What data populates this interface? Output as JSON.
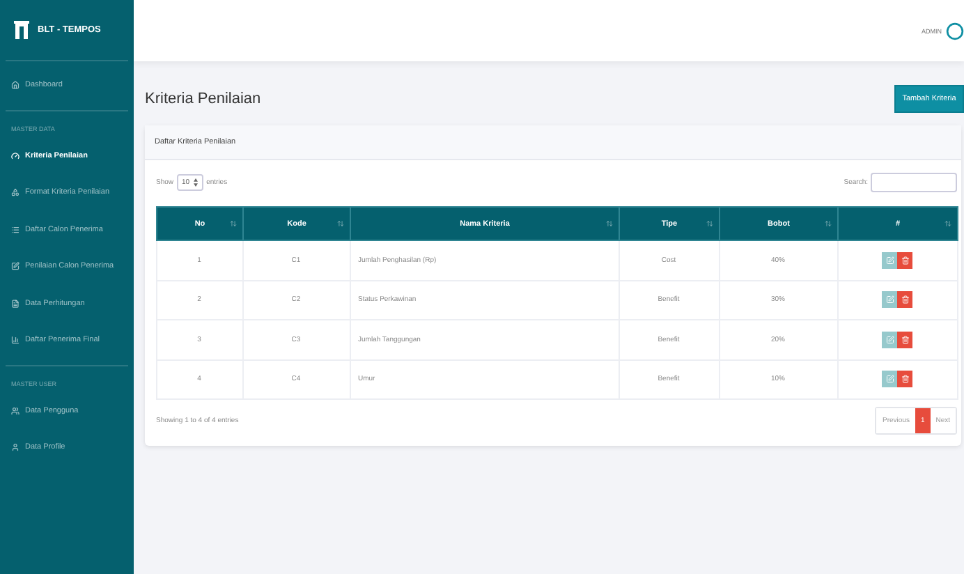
{
  "brand": {
    "title": "BLT - TEMPOS"
  },
  "sidebar": {
    "sections": [
      {
        "items": [
          {
            "label": "Dashboard",
            "selected": false
          }
        ]
      },
      {
        "heading": "MASTER DATA",
        "items": [
          {
            "label": "Kriteria Penilaian",
            "selected": true
          },
          {
            "label": "Format Kriteria Penilaian",
            "selected": false
          },
          {
            "label": "Daftar Calon Penerima",
            "selected": false
          },
          {
            "label": "Penilaian Calon Penerima",
            "selected": false
          },
          {
            "label": "Data Perhitungan",
            "selected": false
          },
          {
            "label": "Daftar Penerima Final",
            "selected": false
          }
        ]
      },
      {
        "heading": "MASTER USER",
        "items": [
          {
            "label": "Data Pengguna",
            "selected": false
          },
          {
            "label": "Data Profile",
            "selected": false
          }
        ]
      }
    ]
  },
  "topbar": {
    "user": "ADMIN"
  },
  "page": {
    "title": "Kriteria Penilaian",
    "action": "Tambah Kriteria"
  },
  "card": {
    "title": "Daftar Kriteria Penilaian",
    "length": {
      "before": "Show",
      "value": "10",
      "after": "entries"
    },
    "search": {
      "label": "Search:"
    },
    "table": {
      "columns": [
        "No",
        "Kode",
        "Nama Kriteria",
        "Tipe",
        "Bobot",
        "#"
      ],
      "rows": [
        {
          "cells": [
            "1",
            "C1",
            "Jumlah Penghasilan (Rp)",
            "Cost",
            "40%"
          ]
        },
        {
          "cells": [
            "2",
            "C2",
            "Status Perkawinan",
            "Benefit",
            "30%"
          ]
        },
        {
          "cells": [
            "3",
            "C3",
            "Jumlah Tanggungan",
            "Benefit",
            "20%"
          ]
        },
        {
          "cells": [
            "4",
            "C4",
            "Umur",
            "Benefit",
            "10%"
          ]
        }
      ]
    },
    "info": "Showing 1 to 4 of 4 entries",
    "pagination": [
      {
        "label": "Previous",
        "selected": false
      },
      {
        "label": "1",
        "selected": true
      },
      {
        "label": "Next",
        "selected": false
      }
    ]
  }
}
